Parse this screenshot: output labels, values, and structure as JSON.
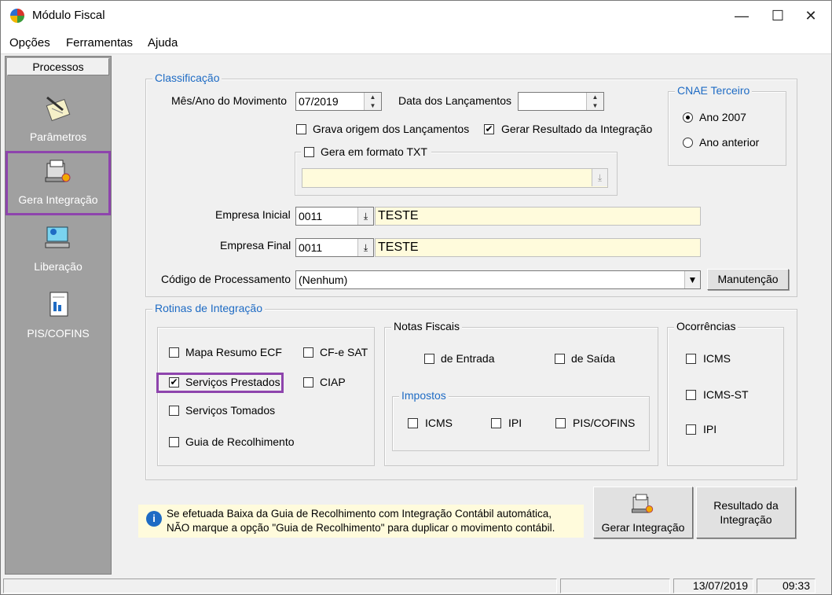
{
  "window": {
    "title": "Módulo Fiscal"
  },
  "menu": [
    "Opções",
    "Ferramentas",
    "Ajuda"
  ],
  "sidebar": {
    "header": "Processos",
    "items": [
      {
        "label": "Parâmetros",
        "icon": "notepad-pen-icon"
      },
      {
        "label": "Gera Integração",
        "icon": "computer-integration-icon"
      },
      {
        "label": "Liberação",
        "icon": "computer-release-icon"
      },
      {
        "label": "PIS/COFINS",
        "icon": "document-tax-icon"
      }
    ],
    "selected": "Gera Integração"
  },
  "classificacao": {
    "title": "Classificação",
    "mes_ano_label": "Mês/Ano do Movimento",
    "mes_ano_value": "07/2019",
    "data_lanc_label": "Data dos Lançamentos",
    "data_lanc_value": "",
    "grava_origem": {
      "label": "Grava origem dos Lançamentos",
      "checked": false
    },
    "gerar_resultado": {
      "label": "Gerar Resultado da Integração",
      "checked": true
    },
    "gera_txt": {
      "label": "Gera em formato TXT",
      "checked": false
    },
    "txt_path": "",
    "empresa_inicial_label": "Empresa Inicial",
    "empresa_inicial_code": "0011",
    "empresa_inicial_name": "TESTE",
    "empresa_final_label": "Empresa Final",
    "empresa_final_code": "0011",
    "empresa_final_name": "TESTE",
    "codigo_label": "Código de Processamento",
    "codigo_value": "(Nenhum)",
    "manutencao_button": "Manutenção"
  },
  "cnae": {
    "title": "CNAE Terceiro",
    "options": [
      "Ano 2007",
      "Ano anterior"
    ],
    "selected": "Ano 2007"
  },
  "rotinas": {
    "title": "Rotinas de Integração",
    "items": [
      {
        "label": "Mapa Resumo ECF",
        "checked": false
      },
      {
        "label": "CF-e SAT",
        "checked": false
      },
      {
        "label": "Serviços Prestados",
        "checked": true
      },
      {
        "label": "CIAP",
        "checked": false
      },
      {
        "label": "Serviços Tomados",
        "checked": false
      },
      {
        "label": "Guia de Recolhimento",
        "checked": false
      }
    ]
  },
  "notas": {
    "title": "Notas Fiscais",
    "entrada": {
      "label": "de Entrada",
      "checked": false
    },
    "saida": {
      "label": "de Saída",
      "checked": false
    },
    "impostos_title": "Impostos",
    "impostos": [
      {
        "label": "ICMS",
        "checked": false
      },
      {
        "label": "IPI",
        "checked": false
      },
      {
        "label": "PIS/COFINS",
        "checked": false
      }
    ]
  },
  "ocorrencias": {
    "title": "Ocorrências",
    "items": [
      {
        "label": "ICMS",
        "checked": false
      },
      {
        "label": "ICMS-ST",
        "checked": false
      },
      {
        "label": "IPI",
        "checked": false
      }
    ]
  },
  "info": {
    "line1": "Se efetuada Baixa da Guia de Recolhimento com Integração Contábil automática,",
    "line2": "NÃO marque a opção \"Guia de Recolhimento\" para duplicar o movimento contábil."
  },
  "buttons": {
    "gerar": "Gerar Integração",
    "resultado_line1": "Resultado da",
    "resultado_line2": "Integração"
  },
  "status": {
    "date": "13/07/2019",
    "time": "09:33"
  },
  "colors": {
    "accent": "#1e6bc4",
    "highlight": "#8e44ad",
    "field_yellow": "#fffbdc"
  }
}
